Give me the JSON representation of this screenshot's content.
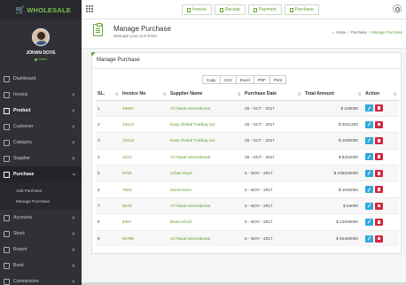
{
  "app": {
    "name": "WHOLESALE"
  },
  "user": {
    "name": "JOHAN DOYE",
    "status": "Online"
  },
  "sidebar": {
    "items": [
      {
        "label": "Dashboard",
        "icon": "dashboard-icon",
        "chevron": false
      },
      {
        "label": "Invoice",
        "icon": "invoice-icon",
        "chevron": true
      },
      {
        "label": "Product",
        "icon": "product-icon",
        "chevron": true,
        "active": true
      },
      {
        "label": "Customer",
        "icon": "customer-icon",
        "chevron": true
      },
      {
        "label": "Category",
        "icon": "category-icon",
        "chevron": true
      },
      {
        "label": "Supplier",
        "icon": "supplier-icon",
        "chevron": true
      },
      {
        "label": "Purchase",
        "icon": "purchase-icon",
        "chevron": true,
        "expanded": true
      }
    ],
    "purchase_sub": [
      "Add Purchase",
      "Manage Purchase"
    ],
    "items_after": [
      {
        "label": "Accounts",
        "icon": "accounts-icon"
      },
      {
        "label": "Stock",
        "icon": "stock-icon"
      },
      {
        "label": "Report",
        "icon": "report-icon"
      },
      {
        "label": "Bank",
        "icon": "bank-icon"
      },
      {
        "label": "Commission",
        "icon": "commission-icon"
      }
    ]
  },
  "topbar": {
    "links": [
      "Invoice",
      "Receipt",
      "Payment",
      "Purchase"
    ]
  },
  "page": {
    "title": "Manage Purchase",
    "subtitle": "Manage your purchase",
    "breadcrumb": {
      "home": "Home",
      "section": "Purchase",
      "current": "Manage Purchase"
    }
  },
  "panel": {
    "title": "Manage Purchase",
    "export_buttons": [
      "Copy",
      "CSV",
      "Excel",
      "PDF",
      "Print"
    ]
  },
  "table": {
    "columns": [
      "SL.",
      "Invoice No",
      "Supplier Name",
      "Purchase Date",
      "Total Amount",
      "Action"
    ],
    "rows": [
      [
        "1",
        "46567",
        "Al Faisal International",
        "26 - OCT - 2017",
        "$ 108000"
      ],
      [
        "2",
        "10213",
        "Easy Global Trading Ltd.",
        "25 - OCT - 2017",
        "$ 3021200"
      ],
      [
        "3",
        "10212",
        "Easy Global Trading Ltd.",
        "25 - OCT - 2017",
        "$ 1560000"
      ],
      [
        "4",
        "1213",
        "Al Faisal International",
        "25 - OCT - 2017",
        "$ 8322000"
      ],
      [
        "5",
        "6756",
        "Johan Doye",
        "6 - NOV - 2017",
        "$ 235200000"
      ],
      [
        "6",
        "7563",
        "Moral Kemi",
        "6 - NOV - 2017",
        "$ 1932000"
      ],
      [
        "7",
        "6578",
        "Al Faisal International",
        "6 - NOV - 2017",
        "$ 54000"
      ],
      [
        "8",
        "6457",
        "Ibram Kholi",
        "6 - NOV - 2017",
        "$ 12000000"
      ],
      [
        "9",
        "56756",
        "Al Faisal International",
        "6 - NOV - 2017",
        "$ 50400000"
      ]
    ]
  },
  "colors": {
    "accent": "#6aa83b",
    "sidebar": "#2f3136",
    "edit": "#2fa8d8",
    "delete": "#d7263d"
  }
}
